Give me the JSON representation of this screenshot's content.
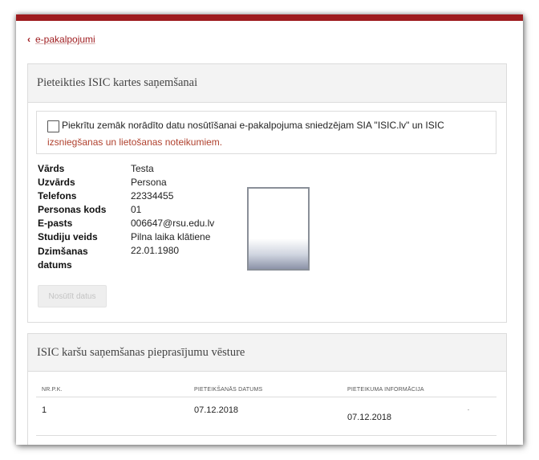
{
  "nav": {
    "back_label": "e-pakalpojumi"
  },
  "application": {
    "title": "Pieteikties ISIC kartes saņemšanai",
    "consent_text": "Piekrītu zemāk norādīto datu nosūtīšanai e-pakalpojuma sniedzējam SIA \"ISIC.lv\" un ISIC",
    "consent_link": "izsniegšanas un lietošanas noteikumiem.",
    "fields": [
      {
        "label": "Vārds",
        "value": "Testa"
      },
      {
        "label": "Uzvārds",
        "value": "Persona"
      },
      {
        "label": "Telefons",
        "value": "22334455"
      },
      {
        "label": "Personas kods",
        "value": "01"
      },
      {
        "label": "E-pasts",
        "value": "006647@rsu.edu.lv"
      },
      {
        "label": "Studiju veids",
        "value": "Pilna laika klātiene"
      },
      {
        "label": "Dzimšanas datums",
        "value": "22.01.1980"
      }
    ],
    "submit_label": "Nosūtīt datus"
  },
  "history": {
    "title": "ISIC karšu saņemšanas pieprasījumu vēsture",
    "columns": [
      "NR.P.K.",
      "PIETEIKŠANĀS DATUMS",
      "PIETEIKUMA INFORMĀCIJA"
    ],
    "rows": [
      {
        "nr": "1",
        "date": "07.12.2018",
        "info": "07.12.2018"
      }
    ]
  }
}
